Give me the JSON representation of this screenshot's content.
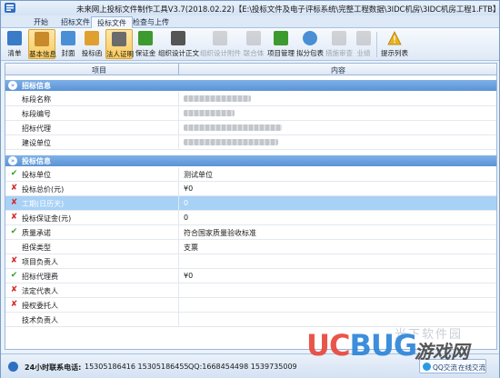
{
  "window": {
    "title": "未来网上投标文件制作工具V3.7(2018.02.22)【E:\\投标文件及电子评标系统\\完整工程数据\\3IDC机房\\3IDC机房工程1.FTB】"
  },
  "tabs": [
    {
      "label": "开始"
    },
    {
      "label": "招标文件"
    },
    {
      "label": "投标文件"
    },
    {
      "label": "检查与上传"
    }
  ],
  "ribbon": {
    "buttons": [
      {
        "label": "清单",
        "icon": "list-icon",
        "color": "#3a7bc8"
      },
      {
        "label": "基本信息",
        "icon": "info-doc-icon",
        "color": "#c88a2a"
      },
      {
        "label": "封面",
        "icon": "cover-icon",
        "color": "#4a8fd6"
      },
      {
        "label": "投标函",
        "icon": "letter-icon",
        "color": "#e0a030"
      },
      {
        "label": "法人证明",
        "icon": "legal-person-icon",
        "color": "#6b6b6b"
      },
      {
        "label": "保证金",
        "icon": "yen-icon",
        "color": "#3d9a2f"
      },
      {
        "label": "组织设计正文",
        "icon": "pen-icon",
        "color": "#555555"
      },
      {
        "label": "组织设计附件",
        "icon": "attachment-icon",
        "color": "#8f8f8f"
      },
      {
        "label": "联合体",
        "icon": "alliance-icon",
        "color": "#8f8f8f"
      },
      {
        "label": "项目管理",
        "icon": "org-chart-icon",
        "color": "#3d9a2f"
      },
      {
        "label": "拟分包表",
        "icon": "pie-icon",
        "color": "#4a8fd6"
      },
      {
        "label": "措施审查",
        "icon": "tools-icon",
        "color": "#8f8f8f"
      },
      {
        "label": "业绩",
        "icon": "trophy-icon",
        "color": "#8f8f8f"
      },
      {
        "label": "提示列表",
        "icon": "warning-icon",
        "color": "#e8b21e"
      }
    ]
  },
  "grid": {
    "col_item": "项目",
    "col_content": "内容",
    "section1": {
      "title": "招标信息",
      "rows": [
        {
          "name": "标段名称",
          "blurred": true
        },
        {
          "name": "标段编号",
          "blurred": true
        },
        {
          "name": "招标代理",
          "blurred": true
        },
        {
          "name": "建设单位",
          "blurred": true
        }
      ]
    },
    "section2": {
      "title": "投标信息",
      "rows": [
        {
          "mark": "✔",
          "name": "投标单位",
          "value": "测试单位"
        },
        {
          "mark": "✘",
          "name": "投标总价(元)",
          "value": "¥0"
        },
        {
          "mark": "✘",
          "name": "工期(日历天)",
          "value": "0",
          "highlight": true
        },
        {
          "mark": "✘",
          "name": "投标保证金(元)",
          "value": "0"
        },
        {
          "mark": "✔",
          "name": "质量承诺",
          "value": "符合国家质量验收标准"
        },
        {
          "mark": "",
          "name": "担保类型",
          "value": "支票"
        },
        {
          "mark": "✘",
          "name": "项目负责人",
          "value": ""
        },
        {
          "mark": "✔",
          "name": "招标代理费",
          "value": "¥0"
        },
        {
          "mark": "✘",
          "name": "法定代表人",
          "value": ""
        },
        {
          "mark": "✘",
          "name": "授权委托人",
          "value": ""
        },
        {
          "mark": "",
          "name": "技术负责人",
          "value": ""
        }
      ]
    }
  },
  "status": {
    "label": "24小时联系电话:",
    "phones": "15305186416 15305186455",
    "qq": "QQ:1668454498 1539735009",
    "chip": "QQ交流",
    "chip2": "在线交流"
  },
  "watermark": {
    "uc": "UC",
    "bug": "BUG",
    "game": "游戏网",
    "site": "光下软件园"
  }
}
